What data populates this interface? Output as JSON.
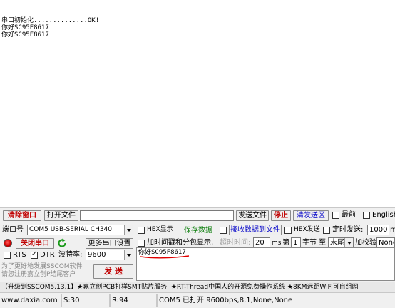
{
  "receive": {
    "lines": [
      "串口初始化..............OK!",
      "你好SC95F8617",
      "你好SC95F8617"
    ]
  },
  "toolbar": {
    "clear_window": "清除窗口",
    "open_file": "打开文件",
    "file_path": "",
    "send_file": "发送文件",
    "stop": "停止",
    "clear_send_area": "清发送区",
    "topmost": "最前",
    "english": "English"
  },
  "port": {
    "port_label": "端口号",
    "port_value": "COM5 USB-SERIAL CH340",
    "close_port": "关闭串口",
    "more_settings": "更多串口设置",
    "rts": "RTS",
    "dtr": "DTR",
    "baud_label": "波特率:",
    "baud_value": "9600"
  },
  "options": {
    "hex_display": "HEX显示",
    "save_data": "保存数据",
    "recv_to_file": "接收数据到文件",
    "hex_send": "HEX发送",
    "timed_send": "定时发送:",
    "interval_value": "1000",
    "interval_unit": "m",
    "add_timestamp": "加时间戳和分包显示,",
    "timeout_label": "超时时间:",
    "timeout_value": "20",
    "timeout_unit": "ms",
    "byte_prefix": "第",
    "byte_value": "1",
    "byte_unit": "字节 至",
    "end_value": "末尾",
    "checksum_label": "加校验",
    "checksum_value": "None"
  },
  "send": {
    "text": "你好SC95F8617",
    "button": "发 送"
  },
  "promo": {
    "line1": "为了更好地发展SSCOM软件",
    "line2": "请您注册嘉立创P结尾客户"
  },
  "ad_bar": {
    "text": "【升级到SSCOM5.13.1】★嘉立创PCB打样SMT贴片服务. ★RT-Thread中国人的开源免费操作系统 ★8KM远距WiFi可自组网"
  },
  "status": {
    "website": "www.daxia.com",
    "s_count": "S:30",
    "r_count": "R:94",
    "port_status": "COM5 已打开  9600bps,8,1,None,None"
  }
}
